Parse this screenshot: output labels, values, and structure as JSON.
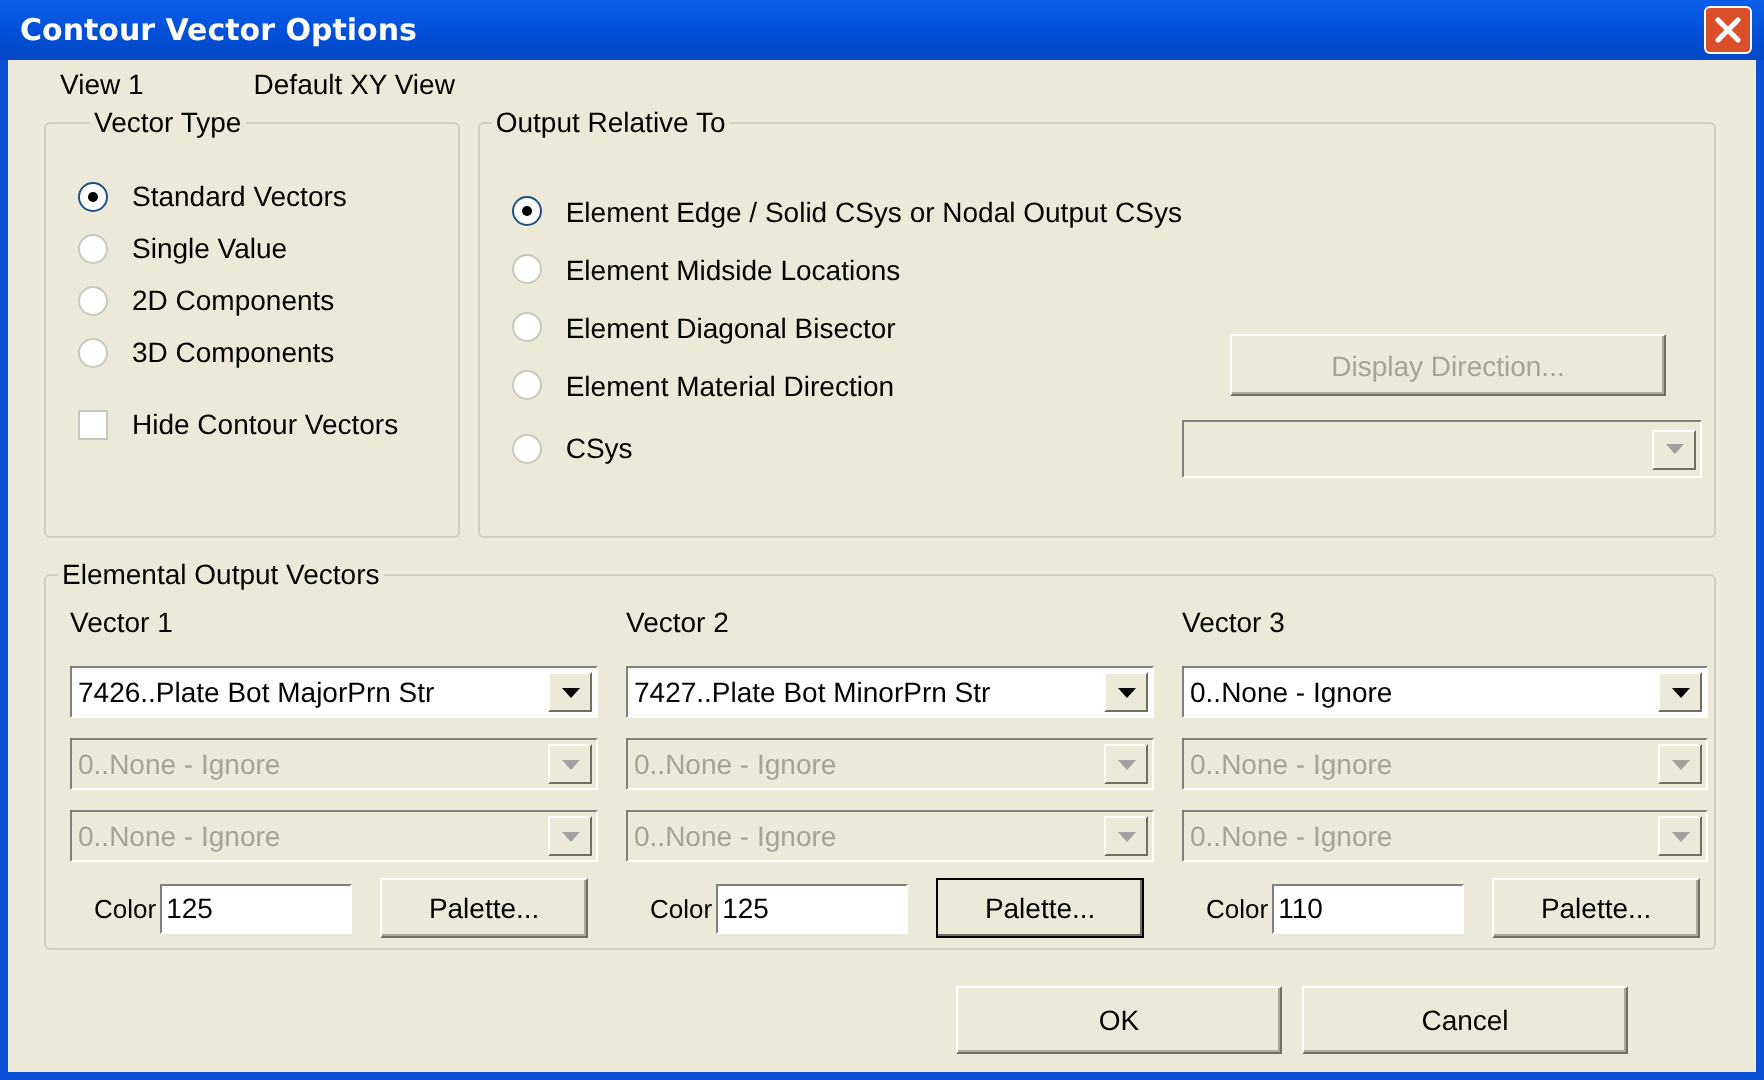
{
  "window": {
    "title": "Contour Vector Options"
  },
  "view": {
    "label": "View 1",
    "name": "Default XY View"
  },
  "vector_type": {
    "title": "Vector Type",
    "options": [
      {
        "label": "Standard Vectors",
        "selected": true
      },
      {
        "label": "Single Value",
        "selected": false
      },
      {
        "label": "2D Components",
        "selected": false
      },
      {
        "label": "3D Components",
        "selected": false
      }
    ],
    "hide_contour_vectors": {
      "label": "Hide Contour Vectors",
      "checked": false
    }
  },
  "output_relative_to": {
    "title": "Output Relative To",
    "options": [
      {
        "label": "Element Edge / Solid CSys or Nodal Output CSys",
        "selected": true
      },
      {
        "label": "Element Midside Locations",
        "selected": false
      },
      {
        "label": "Element Diagonal Bisector",
        "selected": false
      },
      {
        "label": "Element Material Direction",
        "selected": false
      },
      {
        "label": "CSys",
        "selected": false
      }
    ],
    "display_direction_button": {
      "label": "Display Direction...",
      "disabled": true
    },
    "csys_dropdown": {
      "disabled": true
    }
  },
  "elemental_output_vectors": {
    "title": "Elemental Output Vectors",
    "vectors": [
      {
        "label": "Vector 1",
        "dropdowns": [
          {
            "value": "7426..Plate Bot MajorPrn Str",
            "disabled": false
          },
          {
            "value": "0..None - Ignore",
            "disabled": true
          },
          {
            "value": "0..None - Ignore",
            "disabled": true
          }
        ],
        "color_label": "Color",
        "color_value": "125",
        "palette_button": {
          "label": "Palette...",
          "focused": false
        }
      },
      {
        "label": "Vector 2",
        "dropdowns": [
          {
            "value": "7427..Plate Bot MinorPrn Str",
            "disabled": false
          },
          {
            "value": "0..None - Ignore",
            "disabled": true
          },
          {
            "value": "0..None - Ignore",
            "disabled": true
          }
        ],
        "color_label": "Color",
        "color_value": "125",
        "palette_button": {
          "label": "Palette...",
          "focused": true
        }
      },
      {
        "label": "Vector 3",
        "dropdowns": [
          {
            "value": "0..None - Ignore",
            "disabled": false
          },
          {
            "value": "0..None - Ignore",
            "disabled": true
          },
          {
            "value": "0..None - Ignore",
            "disabled": true
          }
        ],
        "color_label": "Color",
        "color_value": "110",
        "palette_button": {
          "label": "Palette...",
          "focused": false
        }
      }
    ]
  },
  "buttons": [
    {
      "label": "OK"
    },
    {
      "label": "Cancel"
    }
  ]
}
